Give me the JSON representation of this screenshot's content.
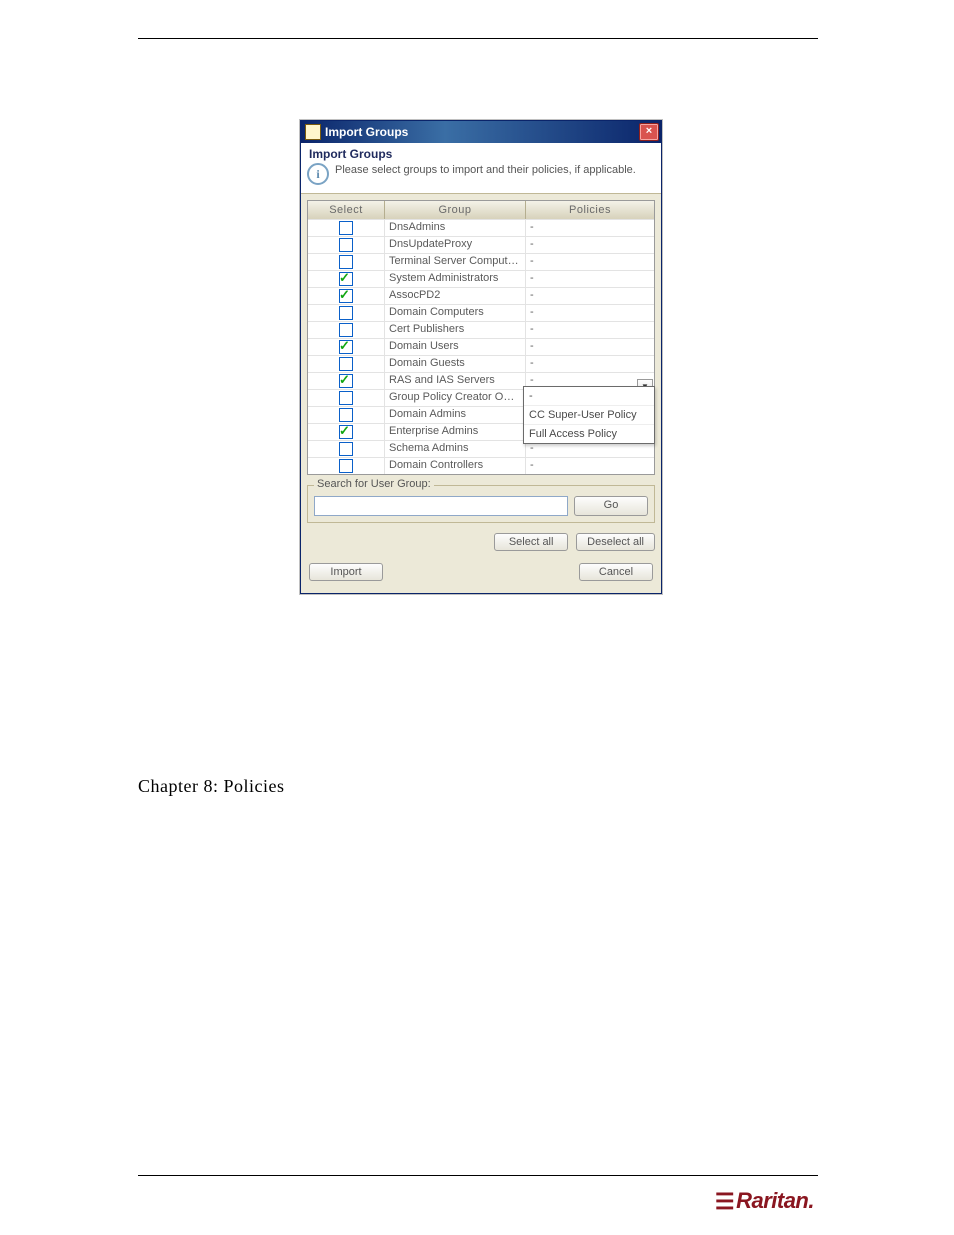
{
  "dialog": {
    "window_title": "Import Groups",
    "section_title": "Import Groups",
    "description": "Please select groups to import and their policies, if applicable.",
    "columns": {
      "select": "Select",
      "group": "Group",
      "policies": "Policies"
    },
    "rows": [
      {
        "checked": false,
        "group": "DnsAdmins",
        "policy": "-"
      },
      {
        "checked": false,
        "group": "DnsUpdateProxy",
        "policy": "-"
      },
      {
        "checked": false,
        "group": "Terminal Server Computers",
        "policy": "-"
      },
      {
        "checked": true,
        "group": "System Administrators",
        "policy": "-"
      },
      {
        "checked": true,
        "group": "AssocPD2",
        "policy": "-"
      },
      {
        "checked": false,
        "group": "Domain Computers",
        "policy": "-"
      },
      {
        "checked": false,
        "group": "Cert Publishers",
        "policy": "-"
      },
      {
        "checked": true,
        "group": "Domain Users",
        "policy": "-"
      },
      {
        "checked": false,
        "group": "Domain Guests",
        "policy": "-"
      },
      {
        "checked": true,
        "group": "RAS and IAS Servers",
        "policy": "-"
      },
      {
        "checked": false,
        "group": "Group Policy Creator Owners",
        "policy": "-"
      },
      {
        "checked": false,
        "group": "Domain Admins",
        "policy": ""
      },
      {
        "checked": true,
        "group": "Enterprise Admins",
        "policy": ""
      },
      {
        "checked": false,
        "group": "Schema Admins",
        "policy": "-"
      },
      {
        "checked": false,
        "group": "Domain Controllers",
        "policy": "-"
      }
    ],
    "policy_options": [
      "-",
      "CC Super-User Policy",
      "Full Access Policy"
    ],
    "search_legend": "Search for User Group:",
    "buttons": {
      "go": "Go",
      "select_all": "Select all",
      "deselect_all": "Deselect all",
      "import": "Import",
      "cancel": "Cancel"
    },
    "close_glyph": "×",
    "info_glyph": "i"
  },
  "chapter_heading": "Chapter 8: Policies",
  "brand": {
    "name": "Raritan",
    "dot": "."
  }
}
